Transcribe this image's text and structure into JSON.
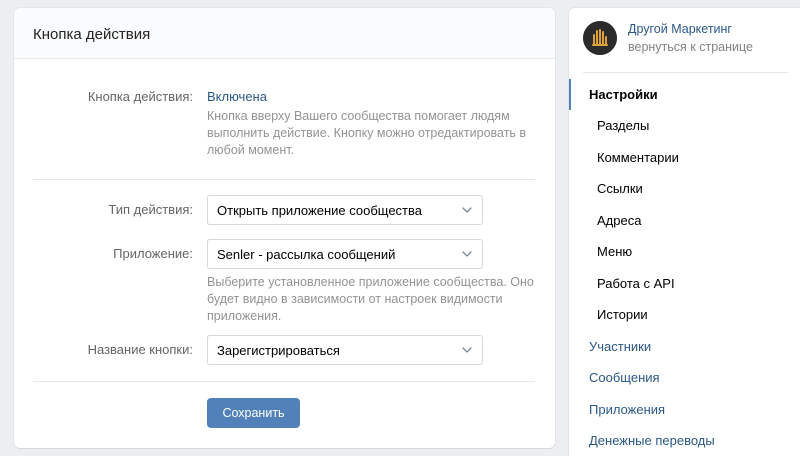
{
  "panel": {
    "title": "Кнопка действия"
  },
  "status": {
    "label": "Кнопка действия:",
    "value": "Включена",
    "hint": "Кнопка вверху Вашего сообщества помогает людям выполнить действие. Кнопку можно отредактировать в любой момент."
  },
  "action_type": {
    "label": "Тип действия:",
    "selected": "Открыть приложение сообщества",
    "icon": "chevron-down-icon"
  },
  "application": {
    "label": "Приложение:",
    "selected": "Senler - рассылка сообщений",
    "hint": "Выберите установленное приложение сообщества. Оно будет видно в зависимости от настроек видимости приложения.",
    "icon": "chevron-down-icon"
  },
  "button_name": {
    "label": "Название кнопки:",
    "selected": "Зарегистрироваться",
    "icon": "chevron-down-icon"
  },
  "save_label": "Сохранить",
  "sidebar": {
    "group_name": "Другой Маркетинг",
    "back_link": "вернуться к странице",
    "items": [
      {
        "label": "Настройки",
        "state": "active"
      },
      {
        "label": "Разделы",
        "state": "sub"
      },
      {
        "label": "Комментарии",
        "state": "sub"
      },
      {
        "label": "Ссылки",
        "state": "sub"
      },
      {
        "label": "Адреса",
        "state": "sub"
      },
      {
        "label": "Меню",
        "state": "sub"
      },
      {
        "label": "Работа с API",
        "state": "sub"
      },
      {
        "label": "Истории",
        "state": "sub"
      },
      {
        "label": "Участники",
        "state": "link"
      },
      {
        "label": "Сообщения",
        "state": "link"
      },
      {
        "label": "Приложения",
        "state": "link"
      },
      {
        "label": "Денежные переводы",
        "state": "link"
      }
    ]
  },
  "colors": {
    "accent": "#5181b8",
    "link": "#2a5885",
    "background": "#edeef0"
  }
}
